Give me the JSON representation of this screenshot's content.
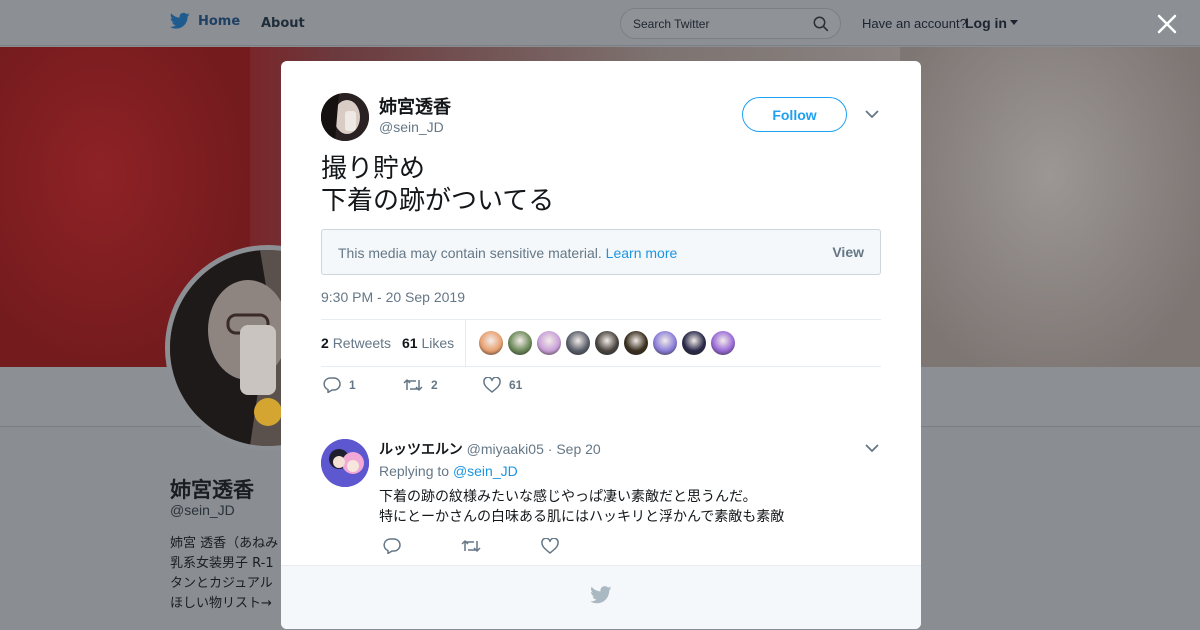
{
  "nav": {
    "home_label": "Home",
    "about_label": "About",
    "search_placeholder": "Search Twitter",
    "account_prompt": "Have an account?",
    "login_label": "Log in"
  },
  "background_profile": {
    "name": "姉宮透香",
    "handle": "@sein_JD",
    "bio_lines": [
      "姉宮 透香（あねみ",
      "乳系女装男子 R-1",
      "タンとカジュアル",
      "ほしい物リスト→"
    ]
  },
  "tweet": {
    "author_name": "姉宮透香",
    "author_handle": "@sein_JD",
    "follow_label": "Follow",
    "text": "撮り貯め\n下着の跡がついてる",
    "sensitive_notice": "This media may contain sensitive material.",
    "sensitive_link": "Learn more",
    "sensitive_view": "View",
    "timestamp": "9:30 PM - 20 Sep 2019",
    "retweets_count": "2",
    "retweets_label": "Retweets",
    "likes_count": "61",
    "likes_label": "Likes",
    "actions": {
      "replies": "1",
      "retweets": "2",
      "likes": "61"
    },
    "liker_colors": [
      "#e8a070",
      "#6d8a5a",
      "#c9a0d8",
      "#5a5f6b",
      "#4a4540",
      "#3a2f1f",
      "#8b7fd9",
      "#2a2a4a",
      "#9a6bd8"
    ]
  },
  "reply": {
    "name": "ルッツエルン",
    "handle": "@miyaaki05",
    "separator": "·",
    "date": "Sep 20",
    "replying_prefix": "Replying to",
    "replying_handle": "@sein_JD",
    "text": "下着の跡の紋様みたいな感じやっぱ凄い素敵だと思うんだ。\n特にとーかさんの白味ある肌にはハッキリと浮かんで素敵も素敵"
  },
  "colors": {
    "accent": "#1da1f2",
    "link": "#1b95e0",
    "muted": "#657786"
  }
}
